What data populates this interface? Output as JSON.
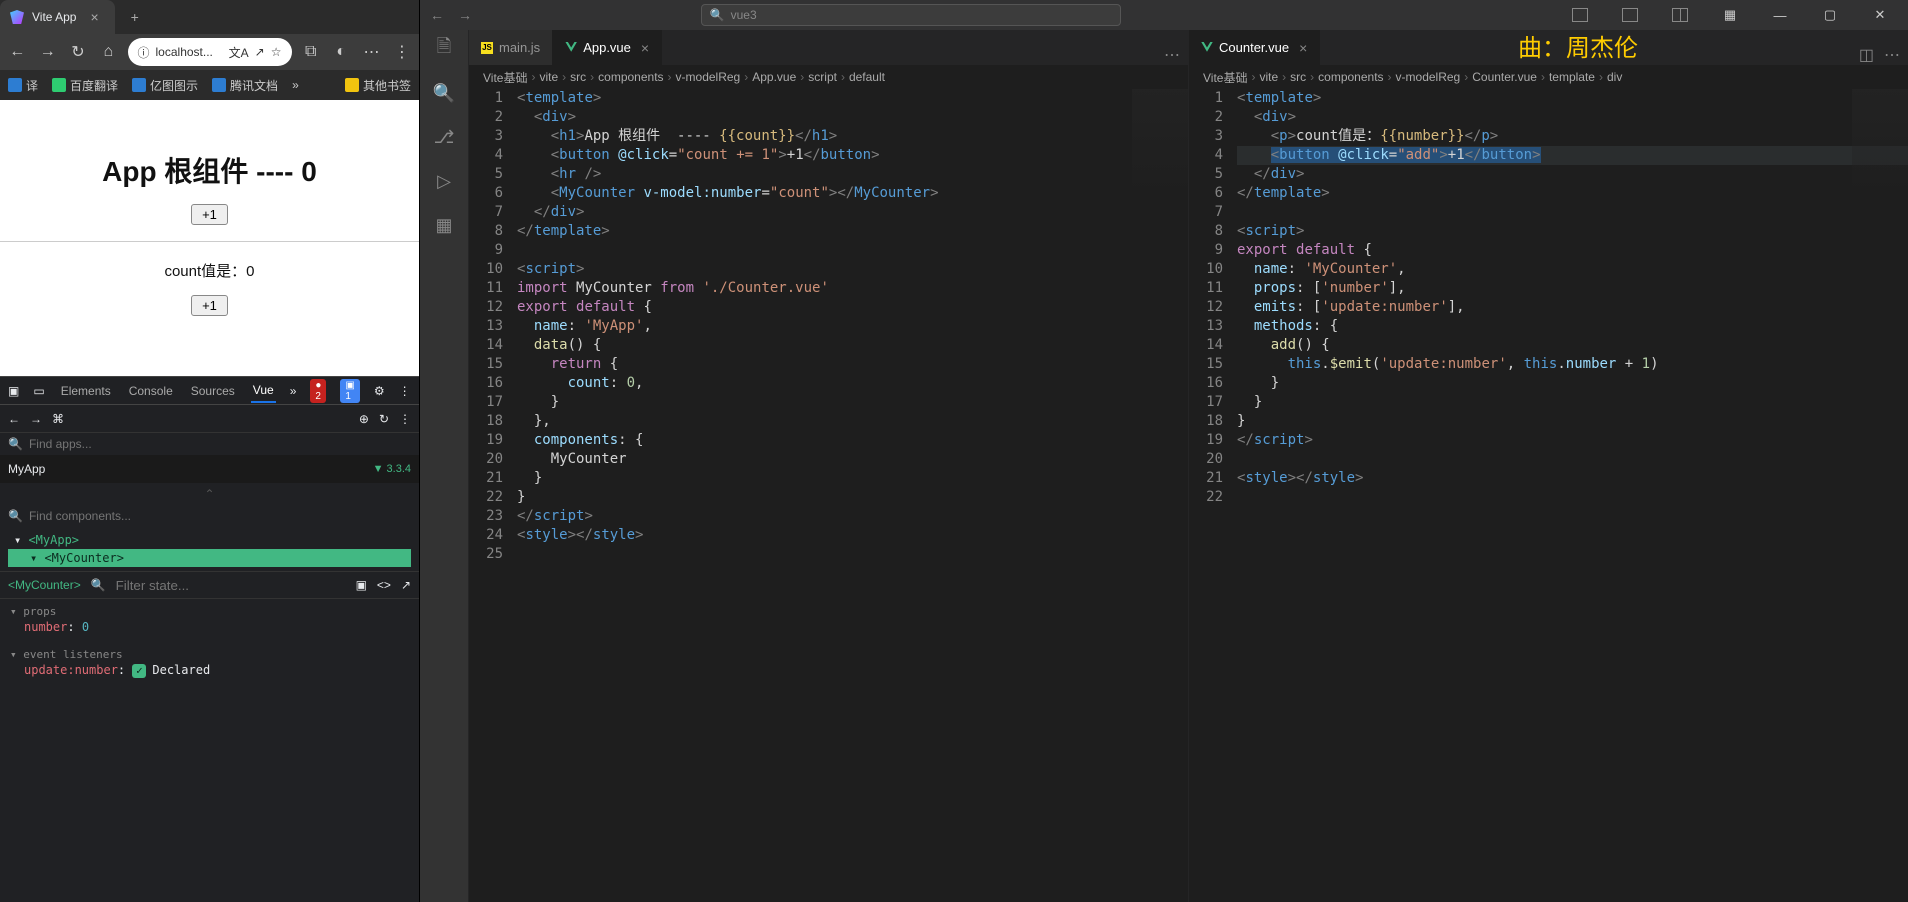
{
  "browser": {
    "tab_title": "Vite App",
    "url_display": "localhost...",
    "toolbar_icons": [
      "←",
      "→",
      "↻",
      "⌂"
    ],
    "addr_right_icons": [
      "文A",
      "↗",
      "☆"
    ],
    "right_icons": [
      "⧉",
      "◐",
      "⋯",
      "⋮"
    ],
    "bookmarks": [
      {
        "label": "译"
      },
      {
        "label": "百度翻译"
      },
      {
        "label": "亿图图示"
      },
      {
        "label": "腾讯文档"
      },
      {
        "label": "»"
      },
      {
        "label": "其他书签"
      }
    ],
    "page": {
      "heading": "App 根组件 ---- 0",
      "btn": "+1",
      "count_line": "count值是：0"
    },
    "devtools": {
      "tabs": [
        "Elements",
        "Console",
        "Sources",
        "Vue"
      ],
      "active_tab": "Vue",
      "error_count": "2",
      "info_count": "1",
      "find_apps_ph": "Find apps...",
      "app_row": "MyApp",
      "vue_version": "3.3.4",
      "find_components_ph": "Find components...",
      "tree": [
        {
          "label": "<MyApp>",
          "depth": 0,
          "sel": false
        },
        {
          "label": "<MyCounter>",
          "depth": 1,
          "sel": true
        }
      ],
      "state_component": "<MyCounter>",
      "filter_state_ph": "Filter state...",
      "props_title": "props",
      "props": [
        {
          "k": "number",
          "v": "0"
        }
      ],
      "events_title": "event listeners",
      "events": [
        {
          "k": "update:number",
          "v": "Declared"
        }
      ]
    }
  },
  "vscode": {
    "search_ph": "vue3",
    "overlay": "曲：周杰伦",
    "activity_tooltips": [
      "Explorer",
      "Search",
      "SCM",
      "Debug",
      "Ext"
    ],
    "left_editor": {
      "tabs": [
        {
          "icon": "js",
          "label": "main.js",
          "active": false,
          "close": false
        },
        {
          "icon": "vue",
          "label": "App.vue",
          "active": true,
          "close": true
        }
      ],
      "crumbs": [
        "Vite基础",
        "vite",
        "src",
        "components",
        "v-modelReg",
        "App.vue",
        "script",
        "default"
      ],
      "lines": [
        [
          {
            "c": "tok-tag",
            "t": "<"
          },
          {
            "c": "tok-el",
            "t": "template"
          },
          {
            "c": "tok-tag",
            "t": ">"
          }
        ],
        [
          {
            "t": "  "
          },
          {
            "c": "tok-tag",
            "t": "<"
          },
          {
            "c": "tok-el",
            "t": "div"
          },
          {
            "c": "tok-tag",
            "t": ">"
          }
        ],
        [
          {
            "t": "    "
          },
          {
            "c": "tok-tag",
            "t": "<"
          },
          {
            "c": "tok-el",
            "t": "h1"
          },
          {
            "c": "tok-tag",
            "t": ">"
          },
          {
            "t": "App 根组件  ---- "
          },
          {
            "c": "tok-mus",
            "t": "{{count}}"
          },
          {
            "c": "tok-tag",
            "t": "</"
          },
          {
            "c": "tok-el",
            "t": "h1"
          },
          {
            "c": "tok-tag",
            "t": ">"
          }
        ],
        [
          {
            "t": "    "
          },
          {
            "c": "tok-tag",
            "t": "<"
          },
          {
            "c": "tok-el",
            "t": "button"
          },
          {
            "t": " "
          },
          {
            "c": "tok-attr",
            "t": "@click"
          },
          {
            "c": "tok-pun",
            "t": "="
          },
          {
            "c": "tok-str",
            "t": "\"count += 1\""
          },
          {
            "c": "tok-tag",
            "t": ">"
          },
          {
            "t": "+1"
          },
          {
            "c": "tok-tag",
            "t": "</"
          },
          {
            "c": "tok-el",
            "t": "button"
          },
          {
            "c": "tok-tag",
            "t": ">"
          }
        ],
        [
          {
            "t": "    "
          },
          {
            "c": "tok-tag",
            "t": "<"
          },
          {
            "c": "tok-el",
            "t": "hr"
          },
          {
            "t": " "
          },
          {
            "c": "tok-tag",
            "t": "/>"
          }
        ],
        [
          {
            "t": "    "
          },
          {
            "c": "tok-tag",
            "t": "<"
          },
          {
            "c": "tok-el",
            "t": "MyCounter"
          },
          {
            "t": " "
          },
          {
            "c": "tok-attr",
            "t": "v-model:number"
          },
          {
            "c": "tok-pun",
            "t": "="
          },
          {
            "c": "tok-str",
            "t": "\"count\""
          },
          {
            "c": "tok-tag",
            "t": "></"
          },
          {
            "c": "tok-el",
            "t": "MyCounter"
          },
          {
            "c": "tok-tag",
            "t": ">"
          }
        ],
        [
          {
            "t": "  "
          },
          {
            "c": "tok-tag",
            "t": "</"
          },
          {
            "c": "tok-el",
            "t": "div"
          },
          {
            "c": "tok-tag",
            "t": ">"
          }
        ],
        [
          {
            "c": "tok-tag",
            "t": "</"
          },
          {
            "c": "tok-el",
            "t": "template"
          },
          {
            "c": "tok-tag",
            "t": ">"
          }
        ],
        [],
        [
          {
            "c": "tok-tag",
            "t": "<"
          },
          {
            "c": "tok-el",
            "t": "script"
          },
          {
            "c": "tok-tag",
            "t": ">"
          }
        ],
        [
          {
            "c": "tok-kw2",
            "t": "import"
          },
          {
            "t": " MyCounter "
          },
          {
            "c": "tok-kw2",
            "t": "from"
          },
          {
            "t": " "
          },
          {
            "c": "tok-str",
            "t": "'./Counter.vue'"
          }
        ],
        [
          {
            "c": "tok-kw2",
            "t": "export"
          },
          {
            "t": " "
          },
          {
            "c": "tok-kw2",
            "t": "default"
          },
          {
            "t": " {"
          }
        ],
        [
          {
            "t": "  "
          },
          {
            "c": "tok-prop",
            "t": "name"
          },
          {
            "t": ": "
          },
          {
            "c": "tok-str",
            "t": "'MyApp'"
          },
          {
            "t": ","
          }
        ],
        [
          {
            "t": "  "
          },
          {
            "c": "tok-fn",
            "t": "data"
          },
          {
            "t": "() {"
          }
        ],
        [
          {
            "t": "    "
          },
          {
            "c": "tok-kw2",
            "t": "return"
          },
          {
            "t": " {"
          }
        ],
        [
          {
            "t": "      "
          },
          {
            "c": "tok-prop",
            "t": "count"
          },
          {
            "t": ": "
          },
          {
            "c": "tok-num",
            "t": "0"
          },
          {
            "t": ","
          }
        ],
        [
          {
            "t": "    }"
          }
        ],
        [
          {
            "t": "  },"
          }
        ],
        [
          {
            "t": "  "
          },
          {
            "c": "tok-prop",
            "t": "components"
          },
          {
            "t": ": {"
          }
        ],
        [
          {
            "t": "    MyCounter"
          }
        ],
        [
          {
            "t": "  }"
          }
        ],
        [
          {
            "t": "}"
          }
        ],
        [
          {
            "c": "tok-tag",
            "t": "</"
          },
          {
            "c": "tok-el",
            "t": "script"
          },
          {
            "c": "tok-tag",
            "t": ">"
          }
        ],
        [
          {
            "c": "tok-tag",
            "t": "<"
          },
          {
            "c": "tok-el",
            "t": "style"
          },
          {
            "c": "tok-tag",
            "t": "></"
          },
          {
            "c": "tok-el",
            "t": "style"
          },
          {
            "c": "tok-tag",
            "t": ">"
          }
        ],
        []
      ]
    },
    "right_editor": {
      "tabs": [
        {
          "icon": "vue",
          "label": "Counter.vue",
          "active": true,
          "close": true
        }
      ],
      "crumbs": [
        "Vite基础",
        "vite",
        "src",
        "components",
        "v-modelReg",
        "Counter.vue",
        "template",
        "div"
      ],
      "cursor_line": 4,
      "lines": [
        [
          {
            "c": "tok-tag",
            "t": "<"
          },
          {
            "c": "tok-el",
            "t": "template"
          },
          {
            "c": "tok-tag",
            "t": ">"
          }
        ],
        [
          {
            "t": "  "
          },
          {
            "c": "tok-tag",
            "t": "<"
          },
          {
            "c": "tok-el",
            "t": "div"
          },
          {
            "c": "tok-tag",
            "t": ">"
          }
        ],
        [
          {
            "t": "    "
          },
          {
            "c": "tok-tag",
            "t": "<"
          },
          {
            "c": "tok-el",
            "t": "p"
          },
          {
            "c": "tok-tag",
            "t": ">"
          },
          {
            "t": "count值是："
          },
          {
            "c": "tok-mus",
            "t": "{{number}}"
          },
          {
            "c": "tok-tag",
            "t": "</"
          },
          {
            "c": "tok-el",
            "t": "p"
          },
          {
            "c": "tok-tag",
            "t": ">"
          }
        ],
        [
          {
            "t": "    "
          },
          {
            "sel": true,
            "c": "tok-tag",
            "t": "<"
          },
          {
            "sel": true,
            "c": "tok-el",
            "t": "button"
          },
          {
            "sel": true,
            "t": " "
          },
          {
            "sel": true,
            "c": "tok-attr",
            "t": "@click"
          },
          {
            "sel": true,
            "c": "tok-pun",
            "t": "="
          },
          {
            "sel": true,
            "c": "tok-str",
            "t": "\"add\""
          },
          {
            "sel": true,
            "c": "tok-tag",
            "t": ">"
          },
          {
            "sel": true,
            "t": "+1"
          },
          {
            "sel": true,
            "c": "tok-tag",
            "t": "</"
          },
          {
            "sel": true,
            "c": "tok-el",
            "t": "button"
          },
          {
            "sel": true,
            "c": "tok-tag",
            "t": ">"
          }
        ],
        [
          {
            "t": "  "
          },
          {
            "c": "tok-tag",
            "t": "</"
          },
          {
            "c": "tok-el",
            "t": "div"
          },
          {
            "c": "tok-tag",
            "t": ">"
          }
        ],
        [
          {
            "c": "tok-tag",
            "t": "</"
          },
          {
            "c": "tok-el",
            "t": "template"
          },
          {
            "c": "tok-tag",
            "t": ">"
          }
        ],
        [],
        [
          {
            "c": "tok-tag",
            "t": "<"
          },
          {
            "c": "tok-el",
            "t": "script"
          },
          {
            "c": "tok-tag",
            "t": ">"
          }
        ],
        [
          {
            "c": "tok-kw2",
            "t": "export"
          },
          {
            "t": " "
          },
          {
            "c": "tok-kw2",
            "t": "default"
          },
          {
            "t": " {"
          }
        ],
        [
          {
            "t": "  "
          },
          {
            "c": "tok-prop",
            "t": "name"
          },
          {
            "t": ": "
          },
          {
            "c": "tok-str",
            "t": "'MyCounter'"
          },
          {
            "t": ","
          }
        ],
        [
          {
            "t": "  "
          },
          {
            "c": "tok-prop",
            "t": "props"
          },
          {
            "t": ": ["
          },
          {
            "c": "tok-str",
            "t": "'number'"
          },
          {
            "t": "],"
          }
        ],
        [
          {
            "t": "  "
          },
          {
            "c": "tok-prop",
            "t": "emits"
          },
          {
            "t": ": ["
          },
          {
            "c": "tok-str",
            "t": "'update:number'"
          },
          {
            "t": "],"
          }
        ],
        [
          {
            "t": "  "
          },
          {
            "c": "tok-prop",
            "t": "methods"
          },
          {
            "t": ": {"
          }
        ],
        [
          {
            "t": "    "
          },
          {
            "c": "tok-fn",
            "t": "add"
          },
          {
            "t": "() {"
          }
        ],
        [
          {
            "t": "      "
          },
          {
            "c": "tok-kw",
            "t": "this"
          },
          {
            "t": "."
          },
          {
            "c": "tok-fn",
            "t": "$emit"
          },
          {
            "t": "("
          },
          {
            "c": "tok-str",
            "t": "'update:number'"
          },
          {
            "t": ", "
          },
          {
            "c": "tok-kw",
            "t": "this"
          },
          {
            "t": "."
          },
          {
            "c": "tok-prop",
            "t": "number"
          },
          {
            "t": " + "
          },
          {
            "c": "tok-num",
            "t": "1"
          },
          {
            "t": ")"
          }
        ],
        [
          {
            "t": "    }"
          }
        ],
        [
          {
            "t": "  }"
          }
        ],
        [
          {
            "t": "}"
          }
        ],
        [
          {
            "c": "tok-tag",
            "t": "</"
          },
          {
            "c": "tok-el",
            "t": "script"
          },
          {
            "c": "tok-tag",
            "t": ">"
          }
        ],
        [],
        [
          {
            "c": "tok-tag",
            "t": "<"
          },
          {
            "c": "tok-el",
            "t": "style"
          },
          {
            "c": "tok-tag",
            "t": "></"
          },
          {
            "c": "tok-el",
            "t": "style"
          },
          {
            "c": "tok-tag",
            "t": ">"
          }
        ],
        []
      ]
    }
  }
}
